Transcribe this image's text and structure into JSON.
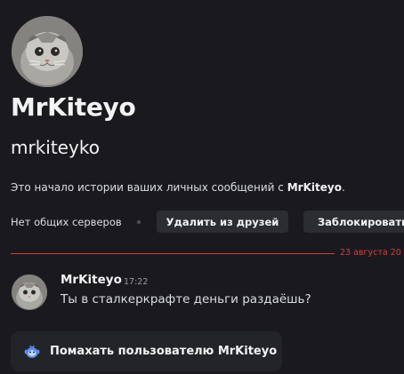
{
  "profile": {
    "avatar_icon": "cat-avatar",
    "display_name": "MrKiteyo",
    "username": "mrkiteyko",
    "intro_prefix": "Это начало истории ваших личных сообщений с ",
    "intro_name": "MrKiteyo",
    "intro_suffix": "."
  },
  "actions": {
    "mutual_servers": "Нет общих серверов",
    "remove_friend": "Удалить из друзей",
    "block": "Заблокировать"
  },
  "divider": {
    "date": "23 августа 20",
    "color": "#d83c3e"
  },
  "message": {
    "author": "MrKiteyo",
    "time": "17:22",
    "text": "Ты в сталкеркрафте деньги раздаёшь?"
  },
  "wave": {
    "label": "Помахать пользователю MrKiteyo",
    "icon": "wumpus-wave-icon"
  }
}
